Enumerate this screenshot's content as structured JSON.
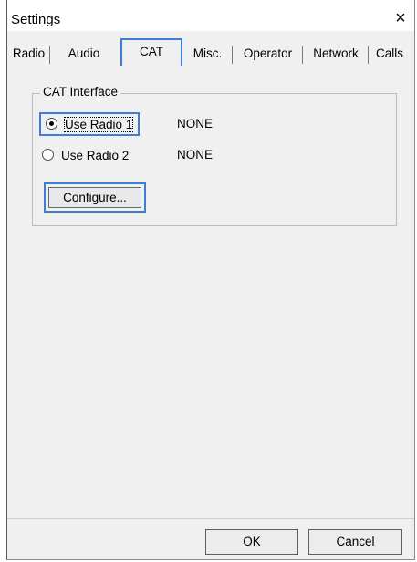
{
  "window": {
    "title": "Settings",
    "close_glyph": "×"
  },
  "tabs": [
    {
      "label": "Radio",
      "active": false
    },
    {
      "label": "Audio",
      "active": false
    },
    {
      "label": "CAT",
      "active": true
    },
    {
      "label": "Misc.",
      "active": false
    },
    {
      "label": "Operator",
      "active": false
    },
    {
      "label": "Network",
      "active": false
    },
    {
      "label": "Calls",
      "active": false
    }
  ],
  "cat_interface": {
    "group_title": "CAT Interface",
    "radio1": {
      "label": "Use Radio 1",
      "status": "NONE",
      "checked": true
    },
    "radio2": {
      "label": "Use Radio 2",
      "status": "NONE",
      "checked": false
    },
    "configure_label": "Configure..."
  },
  "buttons": {
    "ok": "OK",
    "cancel": "Cancel"
  },
  "colors": {
    "focus_accent": "#3d7fd6",
    "dialog_bg": "#f0f0f0"
  }
}
